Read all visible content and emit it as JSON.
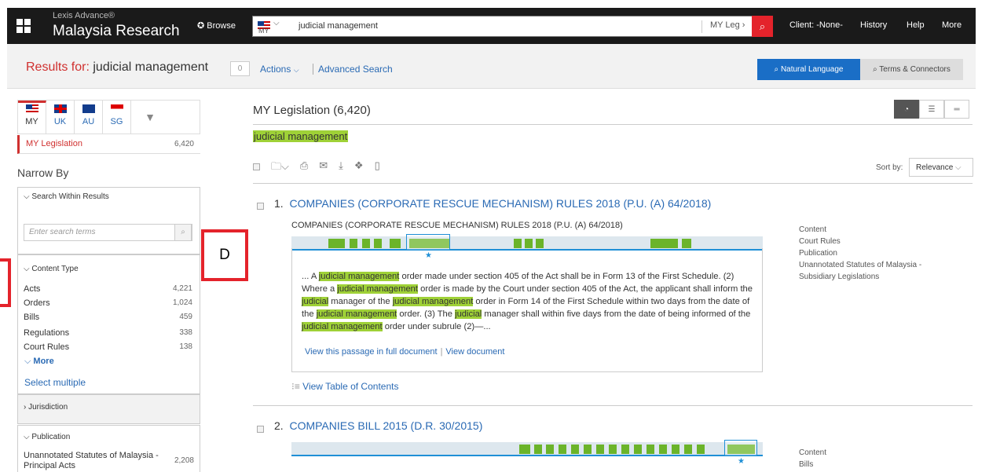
{
  "topbar": {
    "brand_top": "Lexis Advance®",
    "brand_main": "Malaysia Research",
    "browse": "Browse",
    "search_flag_code": "MY",
    "search_query": "judicial management",
    "search_scope": "MY Leg",
    "client": "Client: -None-",
    "history": "History",
    "help": "Help",
    "more": "More"
  },
  "header": {
    "results_for": "Results for:",
    "query": "judicial management",
    "count_box": "0",
    "actions": "Actions",
    "advanced_search": "Advanced Search",
    "natural_language": "Natural Language",
    "terms_connectors": "Terms & Connectors"
  },
  "sidebar": {
    "jurisdiction_tabs": [
      {
        "code": "MY"
      },
      {
        "code": "UK"
      },
      {
        "code": "AU"
      },
      {
        "code": "SG"
      }
    ],
    "content_label": "MY Legislation",
    "content_count": "6,420",
    "narrow_by": "Narrow By",
    "search_within": {
      "title": "Search Within Results",
      "placeholder": "Enter search terms"
    },
    "content_type": {
      "title": "Content Type",
      "items": [
        {
          "label": "Acts",
          "count": "4,221"
        },
        {
          "label": "Orders",
          "count": "1,024"
        },
        {
          "label": "Bills",
          "count": "459"
        },
        {
          "label": "Regulations",
          "count": "338"
        },
        {
          "label": "Court Rules",
          "count": "138"
        }
      ],
      "more": "More"
    },
    "select_multiple": "Select multiple",
    "jurisdiction": "Jurisdiction",
    "publication": {
      "title": "Publication",
      "item_label": "Unannotated Statutes of Malaysia - Principal Acts",
      "item_count": "2,208"
    }
  },
  "annotation": {
    "label": "D"
  },
  "main": {
    "list_title": "MY Legislation (6,420)",
    "query_highlight": "judicial management",
    "sort_label": "Sort by:",
    "sort_value": "Relevance",
    "results": [
      {
        "number": "1.",
        "title": "COMPANIES (CORPORATE RESCUE MECHANISM) RULES 2018 (P.U. (A) 64/2018)",
        "subtitle": "COMPANIES (CORPORATE RESCUE MECHANISM) RULES 2018 (P.U. (A) 64/2018)",
        "snippet_parts": [
          {
            "t": "... A ",
            "h": false
          },
          {
            "t": "judicial management",
            "h": true
          },
          {
            "t": " order made under section 405 of the Act shall be in Form 13 of the First Schedule. (2) Where a ",
            "h": false
          },
          {
            "t": "judicial management",
            "h": true
          },
          {
            "t": " order is made by the Court under section 405 of the Act, the applicant shall inform the ",
            "h": false
          },
          {
            "t": "judicial",
            "h": true
          },
          {
            "t": " manager of the ",
            "h": false
          },
          {
            "t": "judicial management",
            "h": true
          },
          {
            "t": " order in Form 14 of the First Schedule within two days from the date of the ",
            "h": false
          },
          {
            "t": "judicial management",
            "h": true
          },
          {
            "t": " order. (3) The ",
            "h": false
          },
          {
            "t": "judicial",
            "h": true
          },
          {
            "t": " manager shall within five days from the date of being informed of the ",
            "h": false
          },
          {
            "t": "judicial management",
            "h": true
          },
          {
            "t": " order under subrule (2)—...",
            "h": false
          }
        ],
        "view_passage": "View this passage in full document",
        "view_document": "View document",
        "toc": "View Table of Contents",
        "meta": {
          "content_label": "Content",
          "content_value": "Court Rules",
          "publication_label": "Publication",
          "publication_value": "Unannotated Statutes of Malaysia - Subsidiary Legislations"
        }
      },
      {
        "number": "2.",
        "title": "COMPANIES BILL 2015 (D.R. 30/2015)",
        "meta": {
          "content_label": "Content",
          "content_value": "Bills"
        }
      }
    ]
  },
  "colors": {
    "topbar": "#1a1a1a",
    "accent_red": "#e4232b",
    "link_blue": "#2a6ab4",
    "highlight_green": "#9fd137",
    "hitmap_green": "#6bb42a",
    "primary_button": "#1a6ec6"
  }
}
